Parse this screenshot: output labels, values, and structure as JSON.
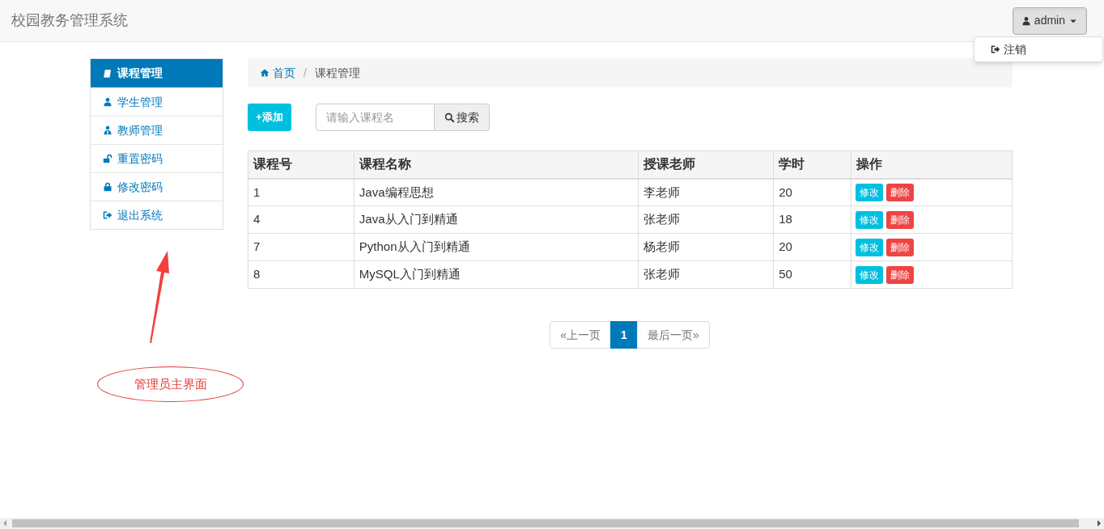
{
  "navbar": {
    "brand": "校园教务管理系统",
    "user_button": "admin",
    "user_menu": [
      {
        "label": "注销",
        "kind": "sign-out"
      }
    ]
  },
  "sidebar": {
    "items": [
      {
        "label": "课程管理",
        "kind": "book",
        "selected": true
      },
      {
        "label": "学生管理",
        "kind": "user",
        "selected": false
      },
      {
        "label": "教师管理",
        "kind": "teacher",
        "selected": false
      },
      {
        "label": "重置密码",
        "kind": "unlock",
        "selected": false
      },
      {
        "label": "修改密码",
        "kind": "lock",
        "selected": false
      },
      {
        "label": "退出系统",
        "kind": "sign-out",
        "selected": false
      }
    ]
  },
  "breadcrumb": {
    "separator": "/",
    "items": [
      {
        "label": "首页",
        "link": true
      },
      {
        "label": "课程管理",
        "link": false
      }
    ]
  },
  "toolbar": {
    "add_button": "+添加",
    "search": {
      "placeholder": "请输入课程名"
    },
    "search_button": "搜索"
  },
  "table": {
    "columns": [
      "课程号",
      "课程名称",
      "授课老师",
      "学时",
      "操作"
    ],
    "rows": [
      {
        "cells": [
          "1",
          "Java编程思想",
          "李老师",
          "20"
        ],
        "actions": [
          {
            "label": "修改",
            "kind": "edit"
          },
          {
            "label": "删除",
            "kind": "delete"
          }
        ]
      },
      {
        "cells": [
          "4",
          "Java从入门到精通",
          "张老师",
          "18"
        ],
        "actions": [
          {
            "label": "修改",
            "kind": "edit"
          },
          {
            "label": "删除",
            "kind": "delete"
          }
        ]
      },
      {
        "cells": [
          "7",
          "Python从入门到精通",
          "杨老师",
          "20"
        ],
        "actions": [
          {
            "label": "修改",
            "kind": "edit"
          },
          {
            "label": "删除",
            "kind": "delete"
          }
        ]
      },
      {
        "cells": [
          "8",
          "MySQL入门到精通",
          "张老师",
          "50"
        ],
        "actions": [
          {
            "label": "修改",
            "kind": "edit"
          },
          {
            "label": "删除",
            "kind": "delete"
          }
        ]
      }
    ]
  },
  "pagination": [
    {
      "label": "«上一页",
      "selected": false
    },
    {
      "label": "1",
      "selected": true
    },
    {
      "label": "最后一页»",
      "selected": false
    }
  ],
  "annotation": {
    "label": "管理员主界面"
  }
}
